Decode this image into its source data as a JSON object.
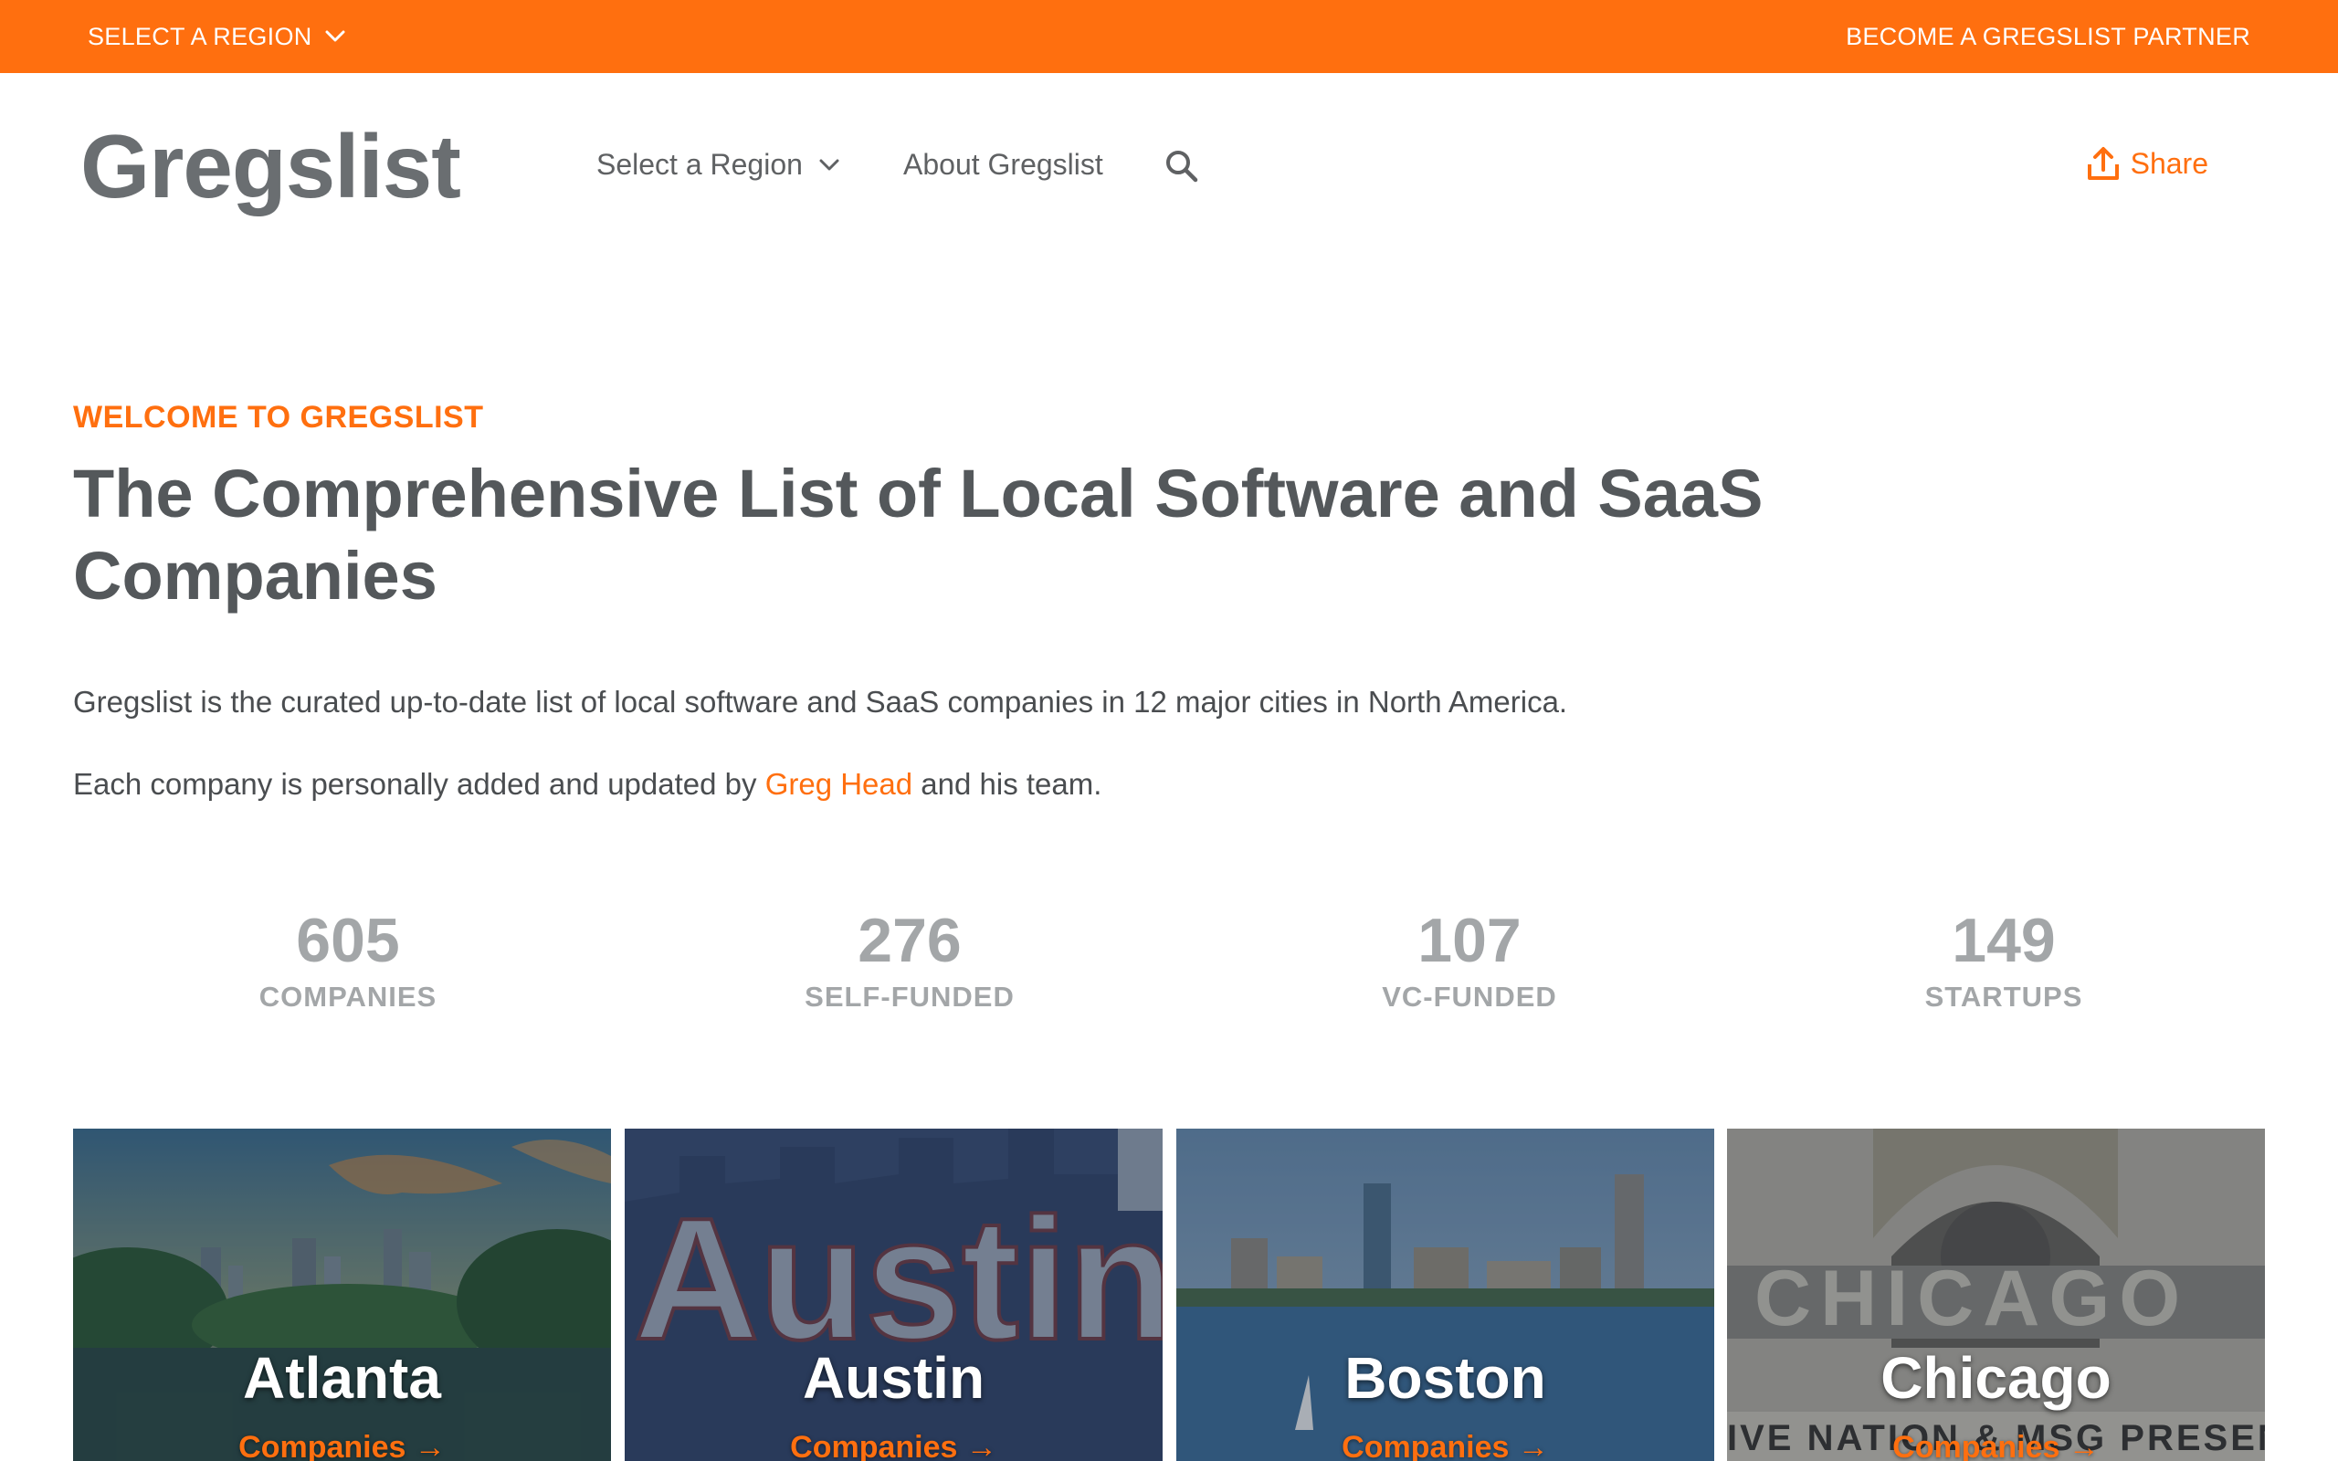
{
  "topbar": {
    "region_label": "SELECT A REGION",
    "partner_label": "BECOME A GREGSLIST PARTNER"
  },
  "header": {
    "logo": "Gregslist",
    "nav": {
      "region_label": "Select a Region",
      "about_label": "About Gregslist"
    },
    "share_label": "Share"
  },
  "hero": {
    "eyebrow": "WELCOME TO GREGSLIST",
    "headline": "The Comprehensive List of Local Software and SaaS Companies",
    "paragraph1": "Gregslist is the curated up-to-date list of local software and SaaS companies in 12 major cities in North America.",
    "paragraph2_before": "Each company is personally added and updated by ",
    "paragraph2_link": "Greg Head",
    "paragraph2_after": " and his team."
  },
  "stats": [
    {
      "number": "605",
      "label": "COMPANIES"
    },
    {
      "number": "276",
      "label": "SELF-FUNDED"
    },
    {
      "number": "107",
      "label": "VC-FUNDED"
    },
    {
      "number": "149",
      "label": "STARTUPS"
    }
  ],
  "cities": [
    {
      "name": "Atlanta",
      "link": "Companies →"
    },
    {
      "name": "Austin",
      "link": "Companies →"
    },
    {
      "name": "Boston",
      "link": "Companies →"
    },
    {
      "name": "Chicago",
      "link": "Companies →"
    }
  ],
  "colors": {
    "accent": "#ff6f0f",
    "text": "#54585b",
    "stat": "#a3a6a8"
  },
  "icons": [
    "chevron-down-icon",
    "search-icon",
    "share-icon",
    "arrow-right-icon"
  ]
}
